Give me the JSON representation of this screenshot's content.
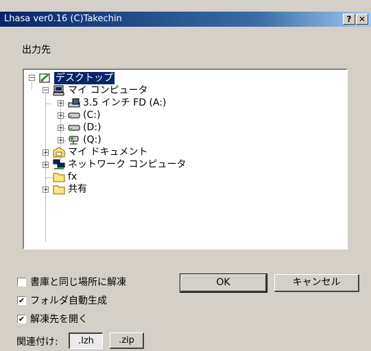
{
  "window": {
    "title": "Lhasa ver0.16 (C)Takechin",
    "help_label": "?",
    "close_label": "✕"
  },
  "dest_label": "出力先",
  "tree": {
    "desktop": "デスクトップ",
    "my_computer": "マイ コンピュータ",
    "floppy": "3.5 インチ FD (A:)",
    "drive_c": "(C:)",
    "drive_d": "(D:)",
    "drive_q": "(Q:)",
    "my_documents": "マイ ドキュメント",
    "network": "ネットワーク コンピュータ",
    "fx": "fx",
    "shared": "共有"
  },
  "options": {
    "same_place": {
      "label": "書庫と同じ場所に解凍",
      "checked": false
    },
    "auto_folder": {
      "label": "フォルダ自動生成",
      "checked": true
    },
    "open_dest": {
      "label": "解凍先を開く",
      "checked": true
    }
  },
  "ok_label": "OK",
  "cancel_label": "キャンセル",
  "association": {
    "label": "関連付け:",
    "lzh": ".lzh",
    "zip": ".zip"
  }
}
